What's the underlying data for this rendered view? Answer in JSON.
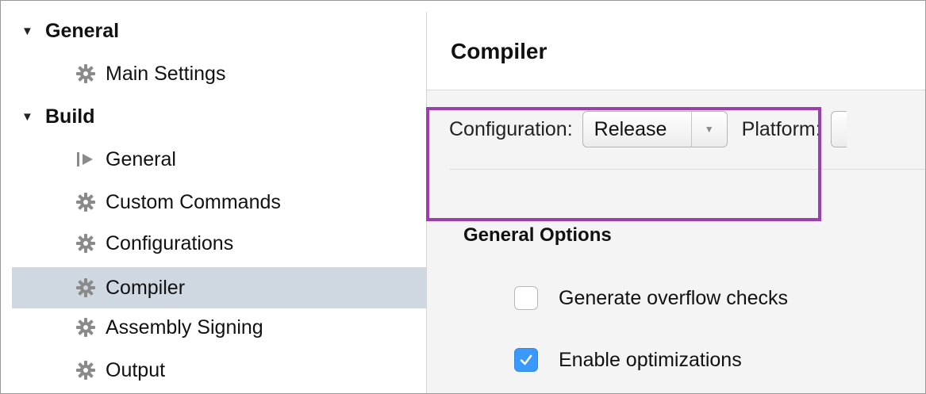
{
  "sidebar": {
    "items": [
      {
        "label": "General",
        "type": "group",
        "icon": "disclosure-triangle-icon"
      },
      {
        "label": "Main Settings",
        "type": "child",
        "icon": "gear-icon"
      },
      {
        "label": "Build",
        "type": "group",
        "icon": "disclosure-triangle-icon"
      },
      {
        "label": "General",
        "type": "child",
        "icon": "run-icon"
      },
      {
        "label": "Custom Commands",
        "type": "child",
        "icon": "gear-icon"
      },
      {
        "label": "Configurations",
        "type": "child",
        "icon": "gear-icon"
      },
      {
        "label": "Compiler",
        "type": "child",
        "icon": "gear-icon",
        "selected": true
      },
      {
        "label": "Assembly Signing",
        "type": "child",
        "icon": "gear-icon"
      },
      {
        "label": "Output",
        "type": "child",
        "icon": "gear-icon"
      }
    ]
  },
  "main": {
    "title": "Compiler",
    "configuration_label": "Configuration:",
    "configuration_value": "Release",
    "platform_label": "Platform:",
    "section_title": "General Options",
    "options": [
      {
        "label": "Generate overflow checks",
        "checked": false
      },
      {
        "label": "Enable optimizations",
        "checked": true
      }
    ]
  },
  "colors": {
    "selection": "#cfd8e1",
    "highlight_border": "#9b3fb0",
    "checkbox_accent": "#3b99fc"
  }
}
